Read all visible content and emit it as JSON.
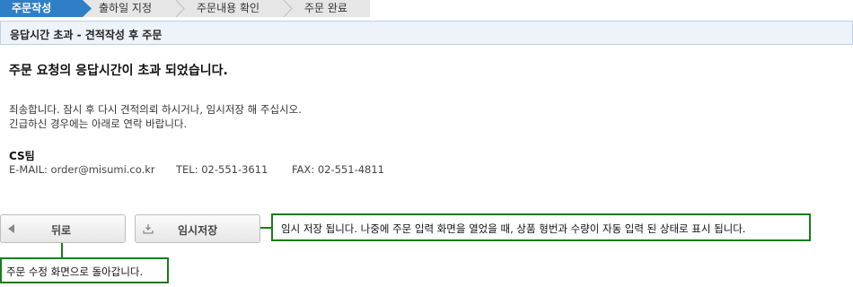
{
  "steps": [
    {
      "label": "주문작성",
      "active": true
    },
    {
      "label": "출하일 지정",
      "active": false
    },
    {
      "label": "주문내용 확인",
      "active": false
    },
    {
      "label": "주문 완료",
      "active": false
    }
  ],
  "section": {
    "title": "응답시간 초과 - 견적작성 후 주문"
  },
  "message": {
    "headline": "주문 요청의 응답시간이 초과 되었습니다.",
    "line1": "죄송합니다. 잠시 후 다시 견적의뢰 하시거나, 임시저장 해 주십시오.",
    "line2": "긴급하신 경우에는 아래로 연락 바랍니다."
  },
  "contact": {
    "team": "CS팀",
    "email": "E-MAIL: order@misumi.co.kr",
    "tel": "TEL: 02-551-3611",
    "fax": "FAX: 02-551-4811"
  },
  "buttons": {
    "back": "뒤로",
    "save": "임시저장"
  },
  "callouts": {
    "save": "임시 저장 됩니다.  나중에 주문 입력 화면을 열었을 때, 상품 형번과 수량이 자동 입력 된 상태로 표시 됩니다.",
    "back": "주문 수정 화면으로 돌아갑니다."
  },
  "colors": {
    "accent": "#2f7fc6",
    "callout_border": "#1d7a1d"
  }
}
